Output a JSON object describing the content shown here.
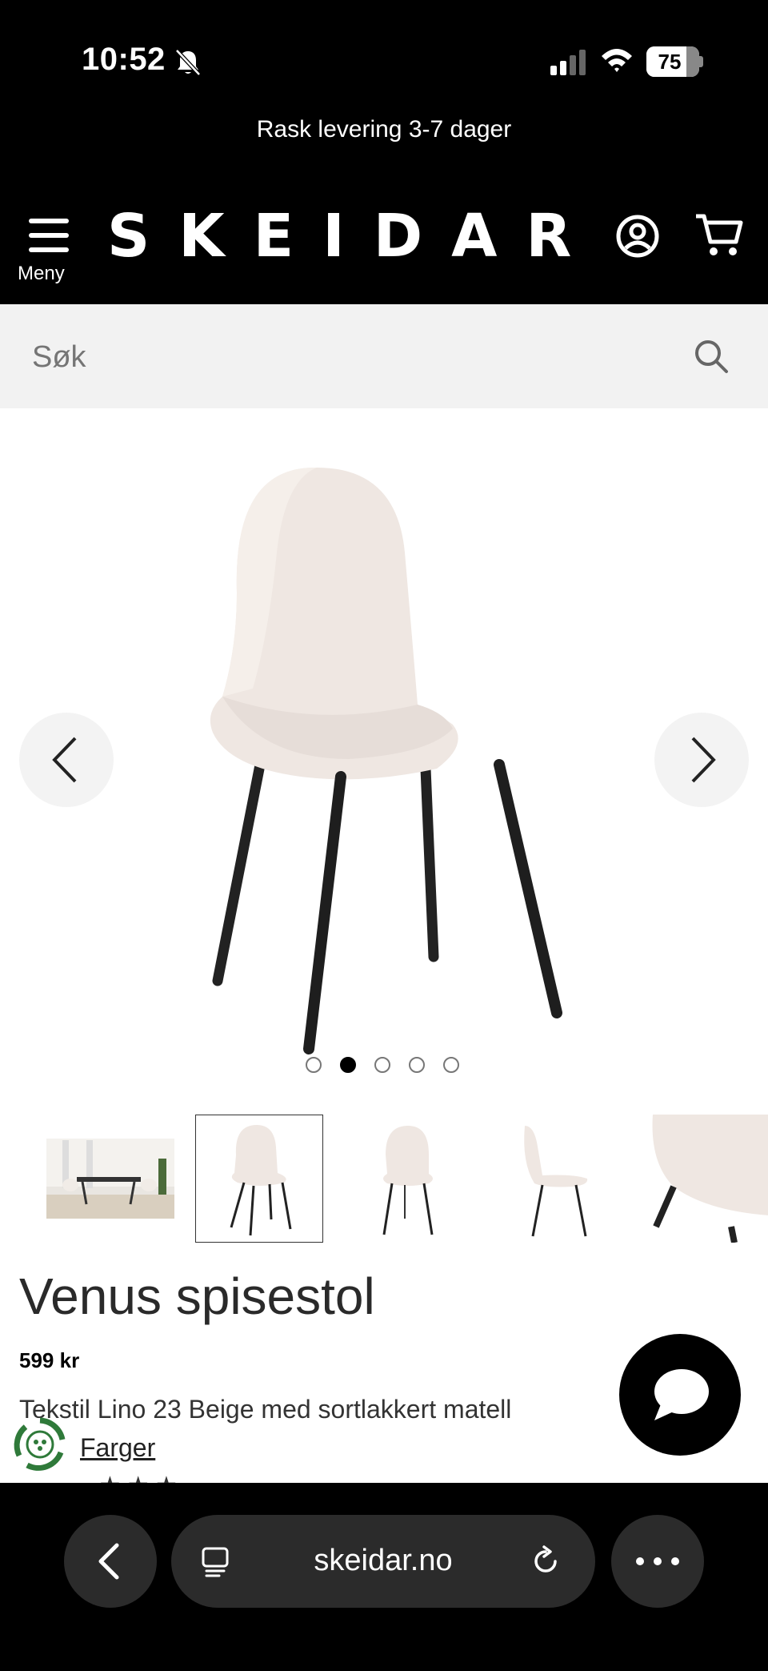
{
  "status_bar": {
    "time": "10:52",
    "battery": "75"
  },
  "promo": {
    "text": "Rask levering 3-7 dager"
  },
  "header": {
    "menu_label": "Meny",
    "logo": "SKEIDAR"
  },
  "search": {
    "placeholder": "Søk"
  },
  "gallery": {
    "active_index": 1,
    "dot_count": 5,
    "thumbnail_count": 5
  },
  "product": {
    "title": "Venus spisestol",
    "price": "599 kr",
    "variant": "Tekstil Lino 23 Beige med sortlakkert matell",
    "link": "Farger"
  },
  "browser": {
    "url": "skeidar.no"
  },
  "colors": {
    "header_bg": "#000000",
    "search_bg": "#f2f2f2",
    "chair_fabric": "#efe7e2",
    "chair_legs": "#222222",
    "eco_green": "#2f7a3a"
  },
  "icons": [
    "bell-slash-icon",
    "signal-icon",
    "wifi-icon",
    "battery-icon",
    "hamburger-icon",
    "account-icon",
    "cart-icon",
    "search-icon",
    "chevron-left-icon",
    "chevron-right-icon",
    "chat-bubble-icon",
    "eco-badge-icon",
    "tabs-icon",
    "reload-icon",
    "more-icon"
  ]
}
